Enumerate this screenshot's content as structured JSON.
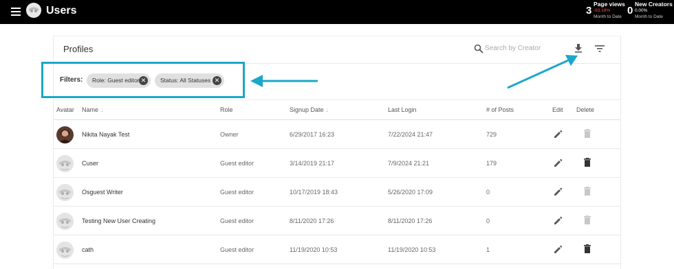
{
  "app": {
    "title": "Users"
  },
  "stats": [
    {
      "value": "3",
      "label": "Page views",
      "change": "-93.18%",
      "change_color": "#ff4d4d",
      "period": "Month to Date"
    },
    {
      "value": "0",
      "label": "New Creators",
      "change": "0.00%",
      "change_color": "#ffffff",
      "period": "Month to Date"
    }
  ],
  "profiles": {
    "title": "Profiles",
    "search_placeholder": "Search by Creator",
    "filters_label": "Filters:",
    "chips": [
      "Role: Guest editor",
      "Status: All Statuses"
    ]
  },
  "table": {
    "columns": [
      "Avatar",
      "Name",
      "Role",
      "Signup Date",
      "Last Login",
      "# of Posts",
      "Edit",
      "Delete"
    ],
    "rows": [
      {
        "name": "Nikita Nayak Test",
        "role": "Owner",
        "signup": "6/29/2017 16:23",
        "last_login": "7/22/2024 21:47",
        "posts": "729",
        "avatar": "photo",
        "delete_enabled": false
      },
      {
        "name": "Cuser",
        "role": "Guest editor",
        "signup": "3/14/2019 21:17",
        "last_login": "7/9/2024 21:21",
        "posts": "179",
        "avatar": "default",
        "delete_enabled": true
      },
      {
        "name": "Osguest Writer",
        "role": "Guest editor",
        "signup": "10/17/2019 18:43",
        "last_login": "5/26/2020 17:09",
        "posts": "0",
        "avatar": "default",
        "delete_enabled": false
      },
      {
        "name": "Testing New User Creating",
        "role": "Guest editor",
        "signup": "8/11/2020 17:26",
        "last_login": "8/11/2020 17:26",
        "posts": "0",
        "avatar": "default",
        "delete_enabled": false
      },
      {
        "name": "cath",
        "role": "Guest editor",
        "signup": "11/19/2020 10:53",
        "last_login": "11/19/2020 10:53",
        "posts": "1",
        "avatar": "default",
        "delete_enabled": true
      }
    ]
  },
  "icons": {
    "menu": "hamburger-icon",
    "search": "search-icon",
    "download": "download-icon",
    "filter": "filter-list-icon",
    "edit": "pencil-icon",
    "delete": "trash-icon",
    "chip_remove": "close-circle-icon"
  },
  "colors": {
    "topbar": "#000000",
    "annotation": "#1aa7c9",
    "delete_active": "#333333",
    "delete_disabled": "#c8c8c8"
  }
}
